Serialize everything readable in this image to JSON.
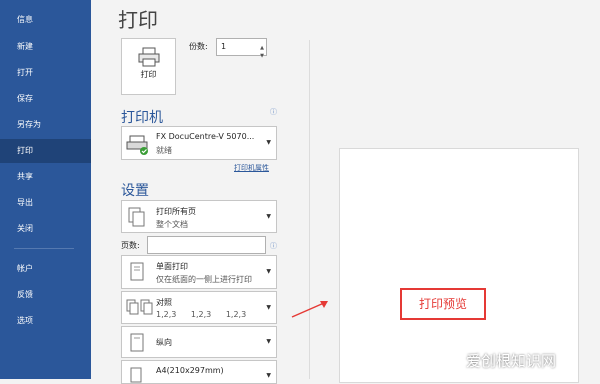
{
  "sidebar": {
    "items": [
      {
        "label": "信息"
      },
      {
        "label": "新建"
      },
      {
        "label": "打开"
      },
      {
        "label": "保存"
      },
      {
        "label": "另存为"
      },
      {
        "label": "打印"
      },
      {
        "label": "共享"
      },
      {
        "label": "导出"
      },
      {
        "label": "关闭"
      },
      {
        "label": "帐户"
      },
      {
        "label": "反馈"
      },
      {
        "label": "选项"
      }
    ],
    "active": "打印",
    "bg_color": "#2b579a"
  },
  "page_title": "打印",
  "print_button_label": "打印",
  "copies": {
    "label": "份数:",
    "value": "1"
  },
  "printer": {
    "section_title": "打印机",
    "name": "FX DocuCentre-V 5070...",
    "status": "就绪",
    "properties_link": "打印机属性"
  },
  "settings": {
    "section_title": "设置",
    "print_range": {
      "l1": "打印所有页",
      "l2": "整个文档"
    },
    "pages_label": "页数:",
    "sides": {
      "l1": "单面打印",
      "l2": "仅在纸面的一侧上进行打印"
    },
    "collate": {
      "l1": "对照",
      "l2a": "1,2,3",
      "l2b": "1,2,3",
      "l2c": "1,2,3"
    },
    "orientation": {
      "l1": "纵向"
    },
    "paper": {
      "l1": "A4(210x297mm)"
    }
  },
  "preview": {
    "annotation": "打印预览",
    "annotation_color": "#e53935"
  },
  "watermark": "爱创根知识网"
}
